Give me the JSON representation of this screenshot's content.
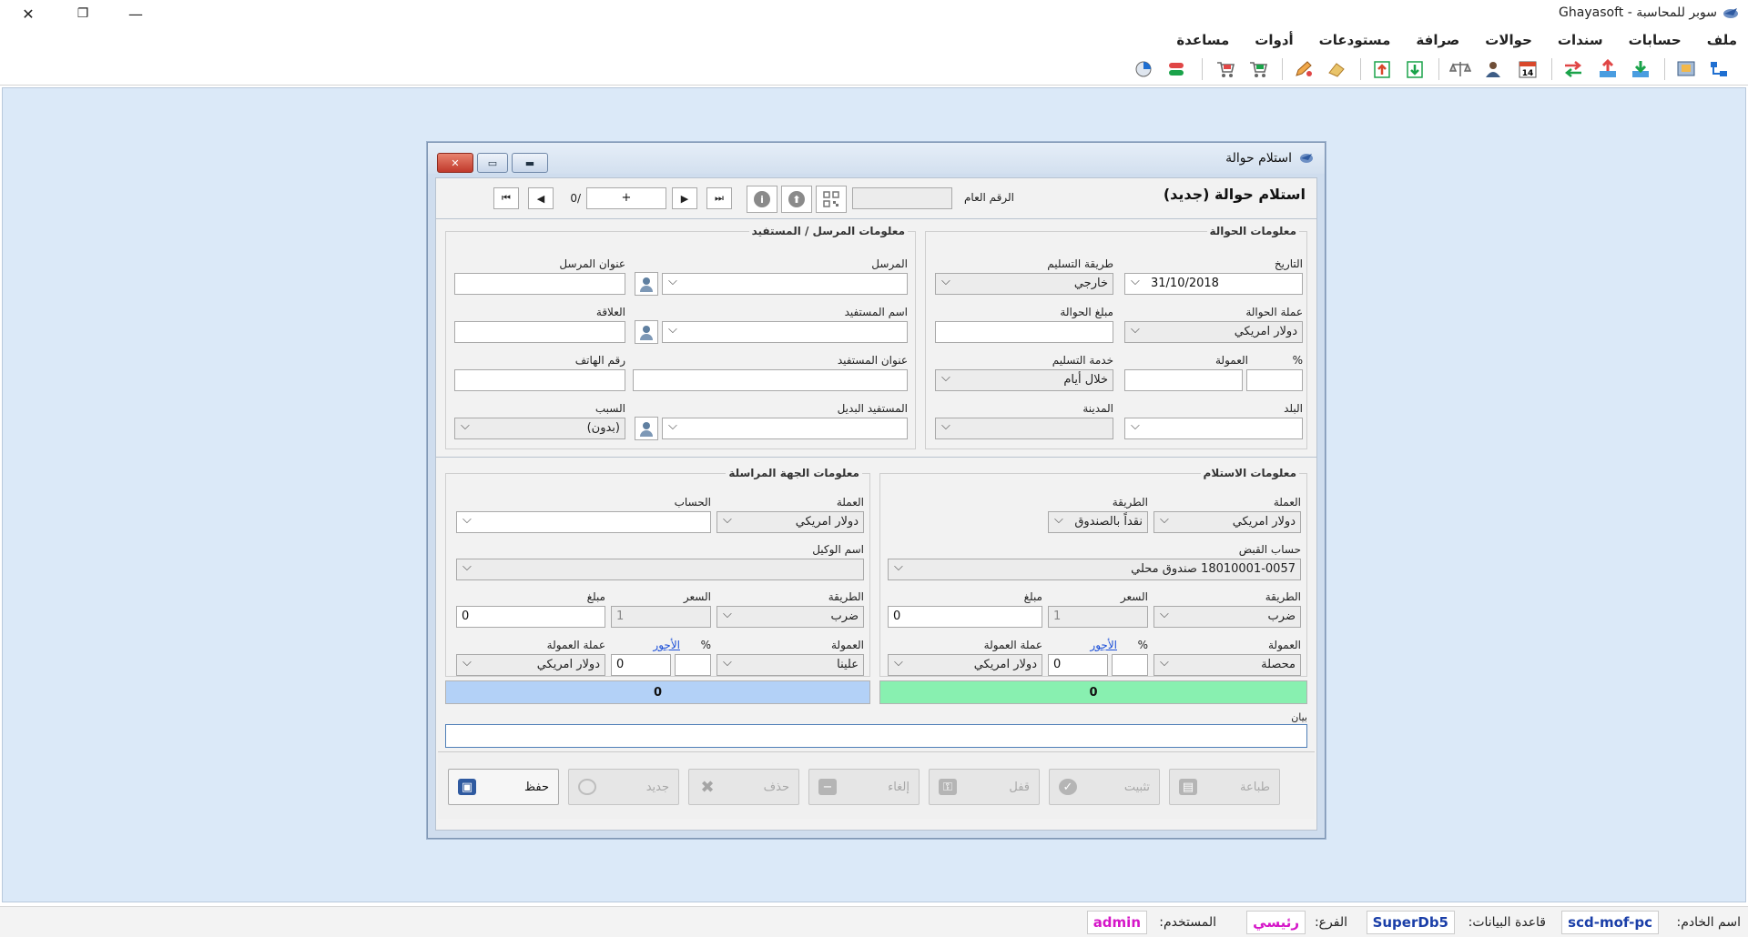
{
  "app": {
    "title": "سوبر للمحاسبة - Ghayasoft",
    "window_controls": {
      "close": "✕",
      "restore": "❐",
      "minimize": "—"
    }
  },
  "menu": [
    "ملف",
    "حسابات",
    "سندات",
    "حوالات",
    "صرافة",
    "مستودعات",
    "أدوات",
    "مساعدة"
  ],
  "toolbar_icons": [
    "network-icon",
    "screen-icon",
    "import-icon",
    "export-icon",
    "transfer-icon",
    "calendar-icon",
    "user-icon",
    "balance-icon",
    "download-icon",
    "upload-icon",
    "eraser-icon",
    "pencil-icon",
    "cart-icon",
    "cart-remove-icon",
    "exchange-icon",
    "pie-chart-icon"
  ],
  "dialog": {
    "title": "استلام حوالة",
    "header_title": "استلام حوالة",
    "header_state": "(جديد)",
    "general_number_label": "الرقم العام",
    "general_number_value": "",
    "nav_record": "+",
    "nav_count": "0/",
    "transfer_info": {
      "title": "معلومات الحوالة",
      "date_label": "التاريخ",
      "date_value": "31/10/2018",
      "delivery_method_label": "طريقة التسليم",
      "delivery_method_value": "خارجي",
      "currency_label": "عملة الحوالة",
      "currency_value": "دولار امريكي",
      "amount_label": "مبلغ الحوالة",
      "amount_value": "",
      "commission_label": "العمولة",
      "percent_label": "%",
      "commission_value": "",
      "percent_value": "",
      "delivery_service_label": "خدمة التسليم",
      "delivery_service_value": "خلال أيام",
      "country_label": "البلد",
      "country_value": "",
      "city_label": "المدينة",
      "city_value": ""
    },
    "parties": {
      "title": "معلومات المرسل / المستفيد",
      "sender_label": "المرسل",
      "sender_address_label": "عنوان المرسل",
      "beneficiary_label": "اسم المستفيد",
      "relation_label": "العلاقة",
      "beneficiary_address_label": "عنوان المستفيد",
      "phone_label": "رقم الهاتف",
      "alt_beneficiary_label": "المستفيد البديل",
      "reason_label": "السبب",
      "reason_value": "(بدون)"
    },
    "receipt": {
      "title": "معلومات الاستلام",
      "currency_label": "العملة",
      "currency_value": "دولار امريكي",
      "method_label": "الطريقة",
      "method_value": "نقداً بالصندوق",
      "account_label": "حساب القبض",
      "account_value": "18010001-0057 صندوق محلي",
      "op_label": "الطريقة",
      "op_value": "ضرب",
      "rate_label": "السعر",
      "rate_value": "1",
      "amount_label": "مبلغ",
      "amount_value": "0",
      "commission_label": "العمولة",
      "commission_value": "محصلة",
      "percent_label": "%",
      "fees_link": "الأجور",
      "commission_amount": "0",
      "commission_currency_label": "عملة العمولة",
      "commission_currency_value": "دولار امريكي",
      "total": "0"
    },
    "correspondent": {
      "title": "معلومات الجهة المراسلة",
      "currency_label": "العملة",
      "currency_value": "دولار امريكي",
      "account_label": "الحساب",
      "account_value": "",
      "agent_label": "اسم الوكيل",
      "agent_value": "",
      "op_label": "الطريقة",
      "op_value": "ضرب",
      "rate_label": "السعر",
      "rate_value": "1",
      "amount_label": "مبلغ",
      "amount_value": "0",
      "commission_label": "العمولة",
      "commission_value": "علينا",
      "percent_label": "%",
      "fees_link": "الأجور",
      "commission_amount": "0",
      "commission_currency_label": "عملة العمولة",
      "commission_currency_value": "دولار امريكي",
      "total": "0"
    },
    "note_label": "بيان",
    "note_value": "",
    "actions": {
      "save": "حفظ",
      "new": "جديد",
      "delete": "حذف",
      "cancel": "إلغاء",
      "lock": "قفل",
      "confirm": "تثبيت",
      "print": "طباعة"
    }
  },
  "status": {
    "server_label": "اسم الخادم:",
    "server_value": "scd-mof-pc",
    "db_label": "قاعدة البيانات:",
    "db_value": "SuperDb5",
    "branch_label": "الفرع:",
    "branch_value": "رئيسي",
    "user_label": "المستخدم:",
    "user_value": "admin"
  },
  "colors": {
    "workspace": "#dbe9f8",
    "receipt_total": "#88f0b0",
    "correspondent_total": "#b3d1f7",
    "status_blue": "#1b3fa8",
    "status_magenta": "#d516c8"
  }
}
